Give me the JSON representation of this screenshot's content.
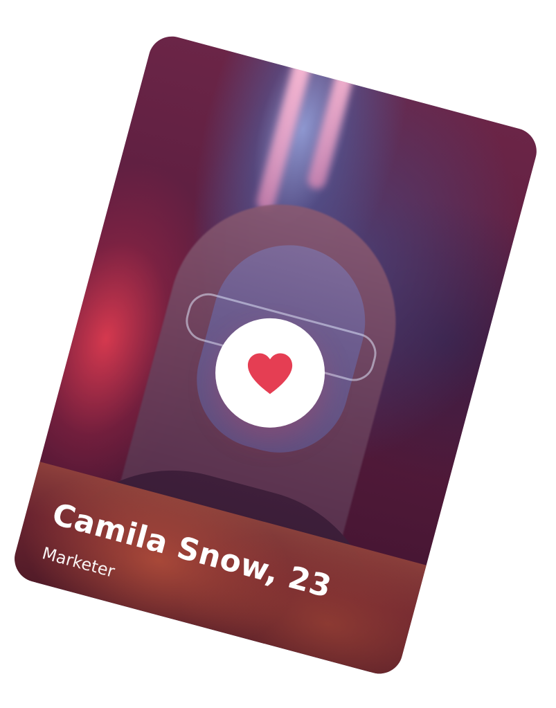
{
  "profile": {
    "name_age": "Camila Snow, 23",
    "occupation": "Marketer"
  },
  "like_button": {
    "icon": "heart-icon"
  },
  "colors": {
    "heart": "#e53e53",
    "button_bg": "#ffffff",
    "card_base": "#5a1d3f",
    "panel": "#6b2430",
    "text": "#ffffff"
  }
}
